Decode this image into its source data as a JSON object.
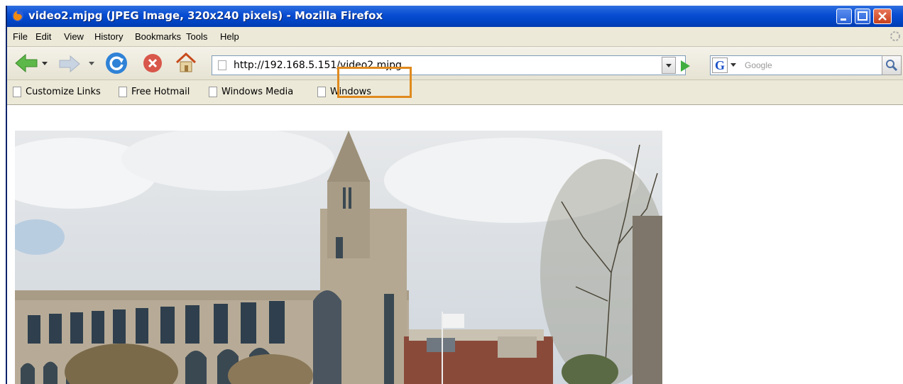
{
  "window": {
    "title": "video2.mjpg (JPEG Image, 320x240 pixels) - Mozilla Firefox"
  },
  "menu": [
    "File",
    "Edit",
    "View",
    "History",
    "Bookmarks",
    "Tools",
    "Help"
  ],
  "navigation": {
    "url": "http://192.168.5.151/video2.mjpg",
    "url_host_part": "http://192.168.5.151",
    "url_path_part": "video2.mjpg",
    "search_placeholder": "Google",
    "search_engine_icon": "google-icon"
  },
  "bookmarks": [
    "Customize Links",
    "Free Hotmail",
    "Windows Media",
    "Windows"
  ],
  "content": {
    "image": "photo of a tall stone tower building with flags and trees"
  },
  "colors": {
    "titlebar": "#0046c6",
    "highlight_box": "#e08a1e",
    "chrome": "#ece9d8"
  }
}
